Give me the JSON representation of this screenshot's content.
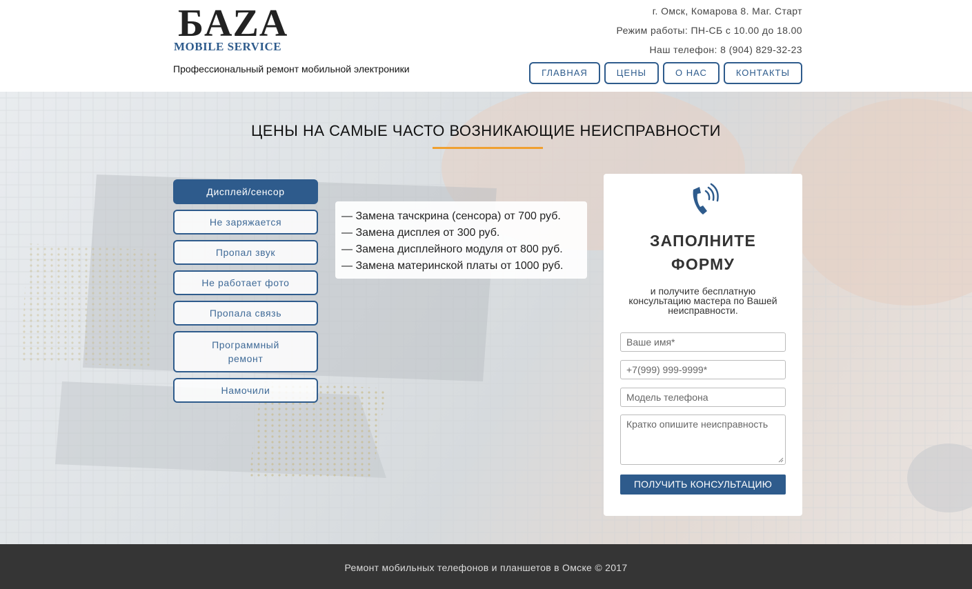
{
  "header": {
    "logo": {
      "top": "БAZA",
      "bottom": "MOBILE SERVICE"
    },
    "tagline": "Профессиональный ремонт мобильной электроники",
    "contacts": {
      "address": "г. Омск, Комарова 8. Маг. Старт",
      "hours": "Режим работы: ПН-СБ с 10.00 до 18.00",
      "phone": "Наш телефон: 8 (904) 829-32-23"
    },
    "nav": [
      {
        "label": "ГЛАВНАЯ"
      },
      {
        "label": "ЦЕНЫ"
      },
      {
        "label": "О НАС"
      },
      {
        "label": "КОНТАКТЫ"
      }
    ]
  },
  "main": {
    "section_title": "ЦЕНЫ НА САМЫЕ ЧАСТО ВОЗНИКАЮЩИЕ НЕИСПРАВНОСТИ",
    "tabs": [
      {
        "label": "Дисплей/сенсор",
        "active": true
      },
      {
        "label": "Не заряжается",
        "active": false
      },
      {
        "label": "Пропал звук",
        "active": false
      },
      {
        "label": "Не работает фото",
        "active": false
      },
      {
        "label": "Пропала связь",
        "active": false
      },
      {
        "label": "Программный ремонт",
        "active": false
      },
      {
        "label": "Намочили",
        "active": false
      }
    ],
    "prices": [
      "— Замена тачскрина (сенсора) от 700 руб.",
      "— Замена дисплея от 300 руб.",
      "— Замена дисплейного модуля от 800 руб.",
      "— Замена материнской платы от 1000 руб."
    ]
  },
  "form": {
    "icon": "phone-ringing-icon",
    "title_line1": "ЗАПОЛНИТЕ",
    "title_line2": "ФОРМУ",
    "subtitle": "и получите бесплатную консультацию мастера по Вашей неисправности.",
    "name_placeholder": "Ваше имя*",
    "phone_placeholder": "+7(999) 999-9999*",
    "model_placeholder": "Модель телефона",
    "issue_placeholder": "Кратко опишите неисправность",
    "submit_label": "ПОЛУЧИТЬ КОНСУЛЬТАЦИЮ"
  },
  "footer": {
    "text": "Ремонт мобильных телефонов и планшетов в Омске © 2017"
  },
  "colors": {
    "accent": "#2e5b8c",
    "underline": "#f0a030",
    "footer_bg": "#353535"
  }
}
